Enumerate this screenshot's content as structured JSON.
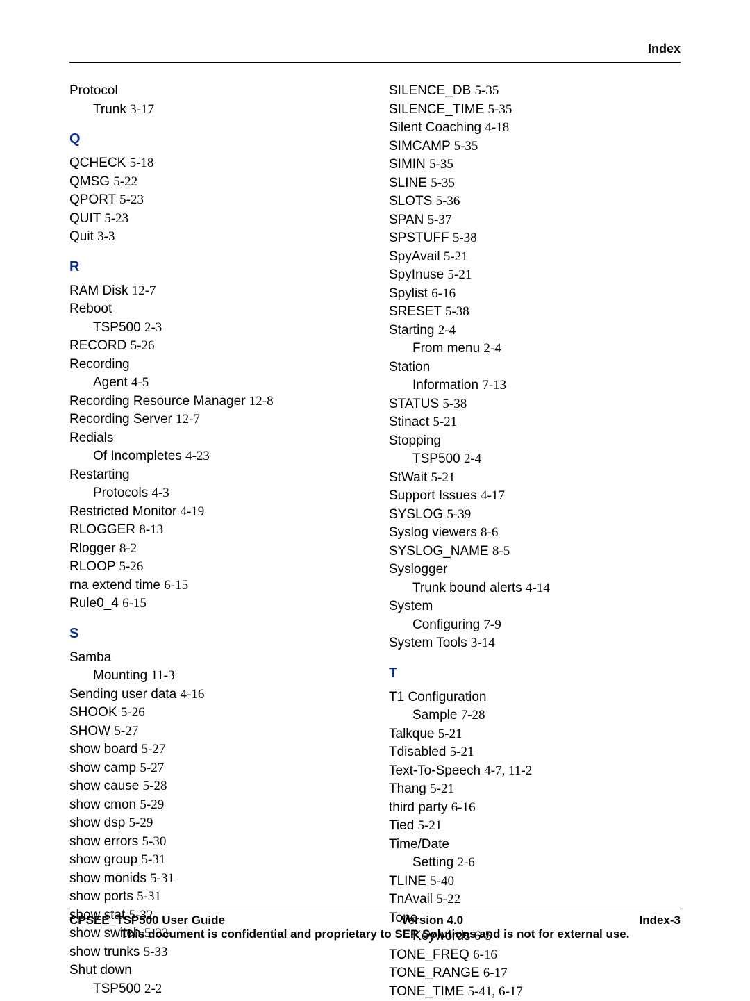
{
  "header": {
    "section_label": "Index"
  },
  "columns": {
    "left": [
      {
        "type": "entry",
        "term": "Protocol",
        "ref": ""
      },
      {
        "type": "sub",
        "term": "Trunk ",
        "ref": "3-17"
      },
      {
        "type": "letter",
        "text": "Q"
      },
      {
        "type": "entry",
        "term": "QCHECK ",
        "ref": "5-18"
      },
      {
        "type": "entry",
        "term": "QMSG ",
        "ref": "5-22"
      },
      {
        "type": "entry",
        "term": "QPORT ",
        "ref": "5-23"
      },
      {
        "type": "entry",
        "term": "QUIT ",
        "ref": "5-23"
      },
      {
        "type": "entry",
        "term": "Quit ",
        "ref": "3-3"
      },
      {
        "type": "letter",
        "text": "R"
      },
      {
        "type": "entry",
        "term": "RAM Disk ",
        "ref": "12-7"
      },
      {
        "type": "entry",
        "term": "Reboot",
        "ref": ""
      },
      {
        "type": "sub",
        "term": "TSP500 ",
        "ref": "2-3"
      },
      {
        "type": "entry",
        "term": "RECORD ",
        "ref": "5-26"
      },
      {
        "type": "entry",
        "term": "Recording",
        "ref": ""
      },
      {
        "type": "sub",
        "term": "Agent ",
        "ref": "4-5"
      },
      {
        "type": "entry",
        "term": "Recording Resource Manager ",
        "ref": "12-8"
      },
      {
        "type": "entry",
        "term": "Recording Server ",
        "ref": "12-7"
      },
      {
        "type": "entry",
        "term": "Redials",
        "ref": ""
      },
      {
        "type": "sub",
        "term": "Of Incompletes ",
        "ref": "4-23"
      },
      {
        "type": "entry",
        "term": "Restarting",
        "ref": ""
      },
      {
        "type": "sub",
        "term": "Protocols ",
        "ref": "4-3"
      },
      {
        "type": "entry",
        "term": "Restricted Monitor ",
        "ref": "4-19"
      },
      {
        "type": "entry",
        "term": "RLOGGER ",
        "ref": "8-13"
      },
      {
        "type": "entry",
        "term": "Rlogger ",
        "ref": "8-2"
      },
      {
        "type": "entry",
        "term": "RLOOP ",
        "ref": "5-26"
      },
      {
        "type": "entry",
        "term": "rna extend time ",
        "ref": "6-15"
      },
      {
        "type": "entry",
        "term": "Rule0_4 ",
        "ref": "6-15"
      },
      {
        "type": "letter",
        "text": "S"
      },
      {
        "type": "entry",
        "term": "Samba",
        "ref": ""
      },
      {
        "type": "sub",
        "term": "Mounting ",
        "ref": "11-3"
      },
      {
        "type": "entry",
        "term": "Sending user data ",
        "ref": "4-16"
      },
      {
        "type": "entry",
        "term": "SHOOK ",
        "ref": "5-26"
      },
      {
        "type": "entry",
        "term": "SHOW ",
        "ref": "5-27"
      },
      {
        "type": "entry",
        "term": "show board ",
        "ref": "5-27"
      },
      {
        "type": "entry",
        "term": "show camp ",
        "ref": "5-27"
      },
      {
        "type": "entry",
        "term": "show cause ",
        "ref": "5-28"
      },
      {
        "type": "entry",
        "term": "show cmon ",
        "ref": "5-29"
      },
      {
        "type": "entry",
        "term": "show dsp ",
        "ref": "5-29"
      },
      {
        "type": "entry",
        "term": "show errors ",
        "ref": "5-30"
      },
      {
        "type": "entry",
        "term": "show group ",
        "ref": "5-31"
      },
      {
        "type": "entry",
        "term": "show monids ",
        "ref": "5-31"
      },
      {
        "type": "entry",
        "term": "show ports ",
        "ref": "5-31"
      },
      {
        "type": "entry",
        "term": "show stat ",
        "ref": "5-32"
      },
      {
        "type": "entry",
        "term": "show switch ",
        "ref": "5-33"
      },
      {
        "type": "entry",
        "term": "show trunks ",
        "ref": "5-33"
      },
      {
        "type": "entry",
        "term": "Shut down",
        "ref": ""
      },
      {
        "type": "sub",
        "term": "TSP500 ",
        "ref": "2-2"
      }
    ],
    "right": [
      {
        "type": "entry",
        "term": "SILENCE_DB ",
        "ref": "5-35"
      },
      {
        "type": "entry",
        "term": "SILENCE_TIME ",
        "ref": "5-35"
      },
      {
        "type": "entry",
        "term": "Silent Coaching ",
        "ref": "4-18"
      },
      {
        "type": "entry",
        "term": "SIMCAMP ",
        "ref": "5-35"
      },
      {
        "type": "entry",
        "term": "SIMIN ",
        "ref": "5-35"
      },
      {
        "type": "entry",
        "term": "SLINE ",
        "ref": "5-35"
      },
      {
        "type": "entry",
        "term": "SLOTS ",
        "ref": "5-36"
      },
      {
        "type": "entry",
        "term": "SPAN ",
        "ref": "5-37"
      },
      {
        "type": "entry",
        "term": "SPSTUFF ",
        "ref": "5-38"
      },
      {
        "type": "entry",
        "term": "SpyAvail ",
        "ref": "5-21"
      },
      {
        "type": "entry",
        "term": "SpyInuse ",
        "ref": "5-21"
      },
      {
        "type": "entry",
        "term": "Spylist ",
        "ref": "6-16"
      },
      {
        "type": "entry",
        "term": "SRESET ",
        "ref": "5-38"
      },
      {
        "type": "entry",
        "term": "Starting ",
        "ref": "2-4"
      },
      {
        "type": "sub",
        "term": "From menu ",
        "ref": "2-4"
      },
      {
        "type": "entry",
        "term": "Station",
        "ref": ""
      },
      {
        "type": "sub",
        "term": "Information ",
        "ref": "7-13"
      },
      {
        "type": "entry",
        "term": "STATUS ",
        "ref": "5-38"
      },
      {
        "type": "entry",
        "term": "Stinact ",
        "ref": "5-21"
      },
      {
        "type": "entry",
        "term": "Stopping",
        "ref": ""
      },
      {
        "type": "sub",
        "term": "TSP500 ",
        "ref": "2-4"
      },
      {
        "type": "entry",
        "term": "StWait ",
        "ref": "5-21"
      },
      {
        "type": "entry",
        "term": "Support Issues ",
        "ref": "4-17"
      },
      {
        "type": "entry",
        "term": "SYSLOG ",
        "ref": "5-39"
      },
      {
        "type": "entry",
        "term": "Syslog viewers ",
        "ref": "8-6"
      },
      {
        "type": "entry",
        "term": "SYSLOG_NAME ",
        "ref": "8-5"
      },
      {
        "type": "entry",
        "term": "Syslogger",
        "ref": ""
      },
      {
        "type": "sub",
        "term": "Trunk bound alerts ",
        "ref": "4-14"
      },
      {
        "type": "entry",
        "term": "System",
        "ref": ""
      },
      {
        "type": "sub",
        "term": "Configuring ",
        "ref": "7-9"
      },
      {
        "type": "entry",
        "term": "System Tools ",
        "ref": "3-14"
      },
      {
        "type": "letter",
        "text": "T"
      },
      {
        "type": "entry",
        "term": "T1 Configuration",
        "ref": ""
      },
      {
        "type": "sub",
        "term": "Sample ",
        "ref": "7-28"
      },
      {
        "type": "entry",
        "term": "Talkque ",
        "ref": "5-21"
      },
      {
        "type": "entry",
        "term": "Tdisabled ",
        "ref": "5-21"
      },
      {
        "type": "entry",
        "term": "Text-To-Speech ",
        "ref": "4-7, 11-2"
      },
      {
        "type": "entry",
        "term": "Thang ",
        "ref": "5-21"
      },
      {
        "type": "entry",
        "term": "third party ",
        "ref": "6-16"
      },
      {
        "type": "entry",
        "term": "Tied ",
        "ref": "5-21"
      },
      {
        "type": "entry",
        "term": "Time/Date",
        "ref": ""
      },
      {
        "type": "sub",
        "term": "Setting ",
        "ref": "2-6"
      },
      {
        "type": "entry",
        "term": "TLINE ",
        "ref": "5-40"
      },
      {
        "type": "entry",
        "term": "TnAvail ",
        "ref": "5-22"
      },
      {
        "type": "entry",
        "term": "Tone",
        "ref": ""
      },
      {
        "type": "sub",
        "term": "Keywords ",
        "ref": "6-5"
      },
      {
        "type": "entry",
        "term": "TONE_FREQ ",
        "ref": "6-16"
      },
      {
        "type": "entry",
        "term": "TONE_RANGE ",
        "ref": "6-17"
      },
      {
        "type": "entry",
        "term": "TONE_TIME ",
        "ref": "5-41, 6-17"
      }
    ]
  },
  "footer": {
    "left": "CPSEE_TSP500 User Guide",
    "center": "Version 4.0",
    "right": "Index-3",
    "note": "This document is confidential and proprietary to SER Solutions and is not for external use."
  }
}
